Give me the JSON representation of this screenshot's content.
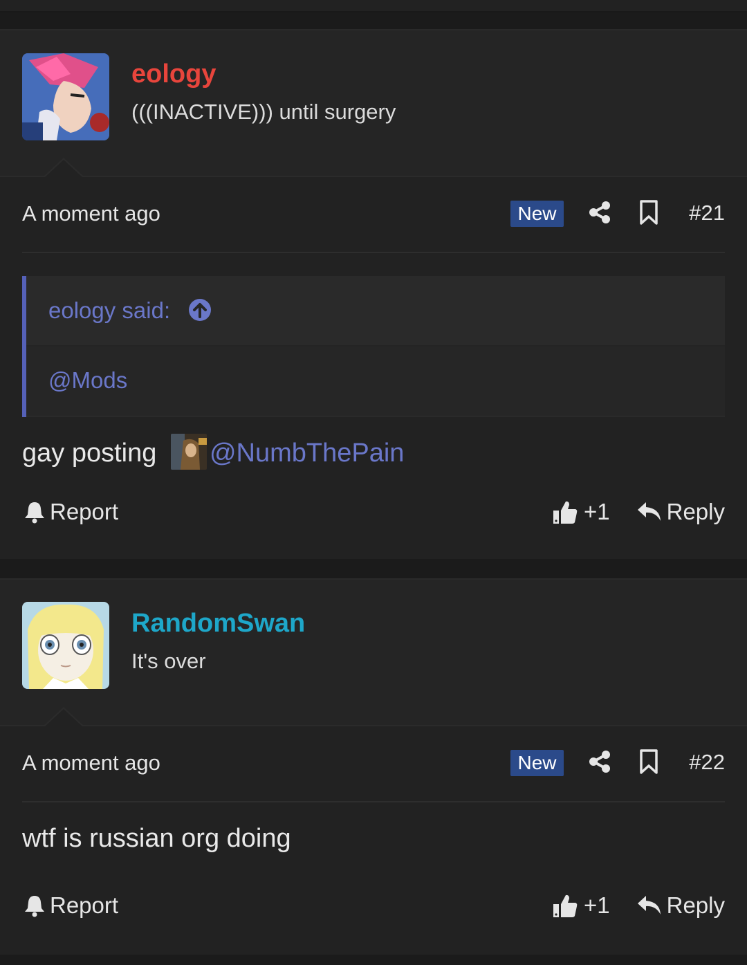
{
  "posts": [
    {
      "username": "eology",
      "username_color": "#e8453c",
      "user_title": "(((INACTIVE))) until surgery",
      "time": "A moment ago",
      "badge": "New",
      "number": "#21",
      "quote": {
        "author": "eology said:",
        "text": "@Mods"
      },
      "body_text": "gay posting",
      "mention": "@NumbThePain",
      "report_label": "Report",
      "like_count": "+1",
      "reply_label": "Reply"
    },
    {
      "username": "RandomSwan",
      "username_color": "#1ea7c9",
      "user_title": "It's over",
      "time": "A moment ago",
      "badge": "New",
      "number": "#22",
      "body_text": "wtf is russian org doing",
      "report_label": "Report",
      "like_count": "+1",
      "reply_label": "Reply"
    }
  ],
  "colors": {
    "background": "#1c1c1c",
    "post_bg": "#222222",
    "accent_link": "#6a77c9",
    "badge_bg": "#2b4a8a"
  },
  "icons": [
    "share-icon",
    "bookmark-icon",
    "arrow-up-circle-icon",
    "bell-icon",
    "thumbs-up-icon",
    "reply-icon"
  ]
}
